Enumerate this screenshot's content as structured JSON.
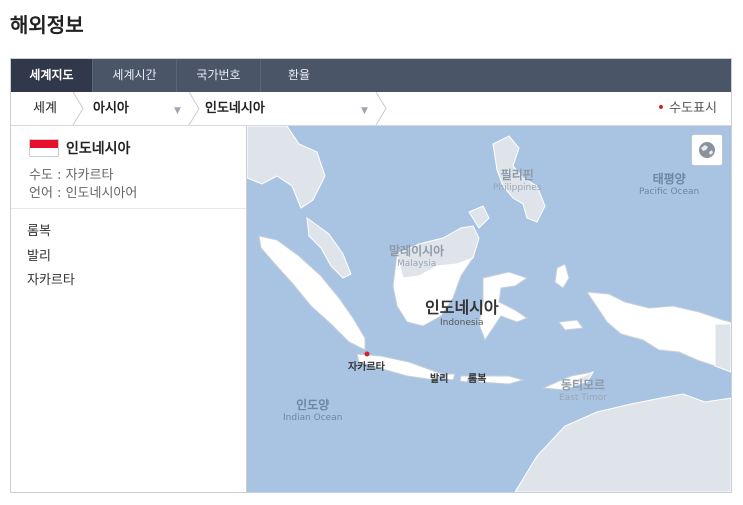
{
  "page": {
    "title": "해외정보"
  },
  "tabs": [
    {
      "label": "세계지도",
      "active": true
    },
    {
      "label": "세계시간",
      "active": false
    },
    {
      "label": "국가번호",
      "active": false
    },
    {
      "label": "환율",
      "active": false
    }
  ],
  "breadcrumb": {
    "world": "세계",
    "region": "아시아",
    "country": "인도네시아",
    "capital_toggle": "수도표시"
  },
  "country": {
    "name": "인도네시아",
    "capital_line": "수도 : 자카르타",
    "language_line": "언어 : 인도네시아어",
    "flag_colors": [
      "#e8112d",
      "#ffffff"
    ]
  },
  "cities": [
    "롬복",
    "발리",
    "자카르타"
  ],
  "map": {
    "labels": {
      "philippines_ko": "필리핀",
      "philippines_en": "Philippines",
      "pacific_ko": "태평양",
      "pacific_en": "Pacific Ocean",
      "malaysia_ko": "말레이시아",
      "malaysia_en": "Malaysia",
      "indonesia_ko": "인도네시아",
      "indonesia_en": "Indonesia",
      "jakarta": "자카르타",
      "bali": "발리",
      "lombok": "롬복",
      "timor_ko": "동티모르",
      "timor_en": "East Timor",
      "indian_ko": "인도양",
      "indian_en": "Indian Ocean"
    },
    "globe_button": "globe-icon",
    "colors": {
      "sea": "#a8c4e2",
      "land": "#ffffff",
      "neighbor": "#dfe4ea"
    }
  }
}
